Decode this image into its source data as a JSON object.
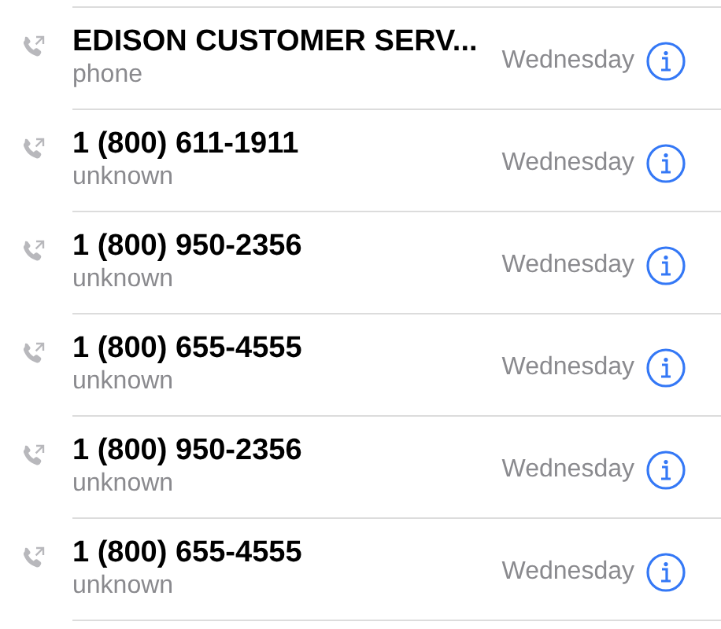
{
  "calls": [
    {
      "name": "EDISON CUSTOMER SERV...",
      "label": "phone",
      "day": "Wednesday"
    },
    {
      "name": "1 (800) 611-1911",
      "label": "unknown",
      "day": "Wednesday"
    },
    {
      "name": "1 (800) 950-2356",
      "label": "unknown",
      "day": "Wednesday"
    },
    {
      "name": "1 (800) 655-4555",
      "label": "unknown",
      "day": "Wednesday"
    },
    {
      "name": "1 (800) 950-2356",
      "label": "unknown",
      "day": "Wednesday"
    },
    {
      "name": "1 (800) 655-4555",
      "label": "unknown",
      "day": "Wednesday"
    }
  ]
}
